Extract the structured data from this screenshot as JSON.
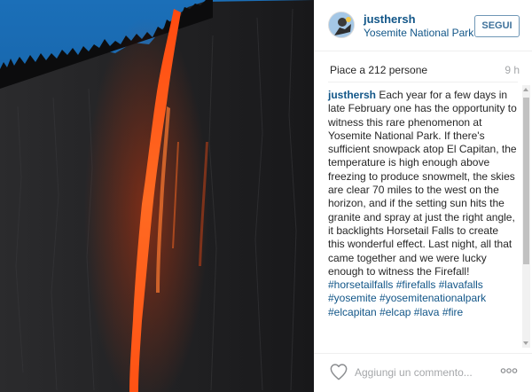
{
  "post": {
    "photo_icon": "horsetail-firefall-photo",
    "header": {
      "avatar_icon": "user-avatar",
      "username": "justhersh",
      "location": "Yosemite National Park",
      "follow_label": "SEGUI"
    },
    "likes_text": "Piace a 212 persone",
    "time_ago": "9 h",
    "caption": {
      "username": "justhersh",
      "text": "Each year for a few days in late February one has the opportunity to witness this rare phenomenon at Yosemite National Park. If there's sufficient snowpack atop El Capitan, the temperature is high enough above freezing to produce snowmelt, the skies are clear 70 miles to the west on the horizon, and if the setting sun hits the granite and spray at just the right angle, it backlights Horsetail Falls to create this wonderful effect. Last night, all that came together and we were lucky enough to witness the Firefall!",
      "hashtags": [
        "#horsetailfalls",
        "#firefalls",
        "#lavafalls",
        "#yosemite",
        "#yosemitenationalpark",
        "#elcapitan",
        "#elcap",
        "#lava",
        "#fire"
      ]
    },
    "footer": {
      "like_icon": "heart-outline-icon",
      "comment_placeholder": "Aggiungi un commento...",
      "more_icon": "more-options-icon"
    }
  },
  "colors": {
    "link_blue": "#125688",
    "follow_border": "#6f97b6",
    "muted_gray": "#a5a7aa",
    "lava_orange": "#ff5a1a"
  }
}
